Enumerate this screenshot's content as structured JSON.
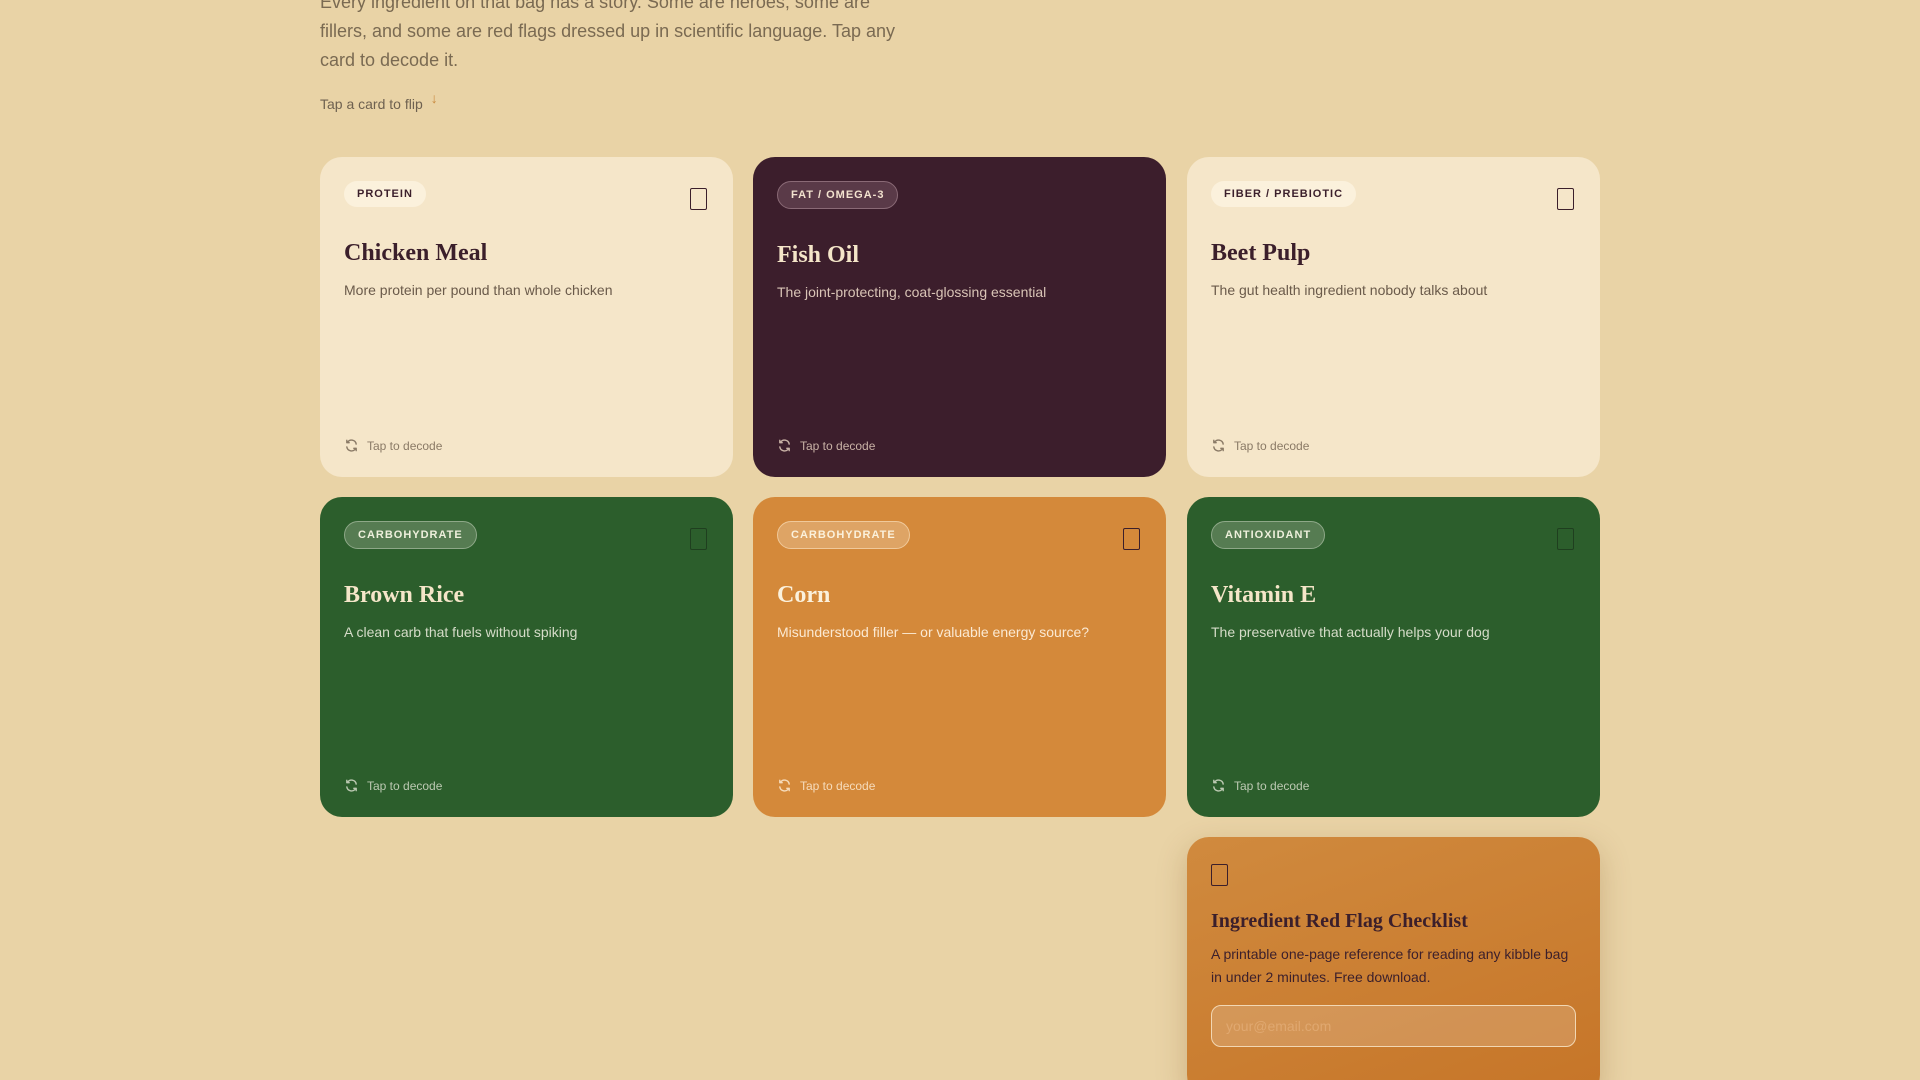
{
  "intro": {
    "text": "Every ingredient on that bag has a story. Some are heroes, some are fillers, and some are red flags dressed up in scientific language. Tap any card to decode it.",
    "hint": "Tap a card to flip",
    "hint_arrow": "↓"
  },
  "cards": [
    {
      "tag": "PROTEIN",
      "title": "Chicken Meal",
      "desc": "More protein per pound than whole chicken",
      "action": "Tap to decode",
      "theme": "cream"
    },
    {
      "tag": "FAT / OMEGA-3",
      "title": "Fish Oil",
      "desc": "The joint-protecting, coat-glossing essential",
      "action": "Tap to decode",
      "theme": "plum"
    },
    {
      "tag": "FIBER / PREBIOTIC",
      "title": "Beet Pulp",
      "desc": "The gut health ingredient nobody talks about",
      "action": "Tap to decode",
      "theme": "cream"
    },
    {
      "tag": "CARBOHYDRATE",
      "title": "Brown Rice",
      "desc": "A clean carb that fuels without spiking",
      "action": "Tap to decode",
      "theme": "green"
    },
    {
      "tag": "CARBOHYDRATE",
      "title": "Corn",
      "desc": "Misunderstood filler — or valuable energy source?",
      "action": "Tap to decode",
      "theme": "orange"
    },
    {
      "tag": "ANTIOXIDANT",
      "title": "Vitamin E",
      "desc": "The preservative that actually helps your dog",
      "action": "Tap to decode",
      "theme": "green"
    }
  ],
  "promo": {
    "title": "Ingredient Red Flag Checklist",
    "text": "A printable one-page reference for reading any kibble bag in under 2 minutes. Free download.",
    "email_placeholder": "your@email.com"
  },
  "colors": {
    "background": "#e9d3a6",
    "cream": "#f5e6c9",
    "plum": "#3c1e2c",
    "green": "#2c5e2c",
    "orange": "#d4893a"
  }
}
